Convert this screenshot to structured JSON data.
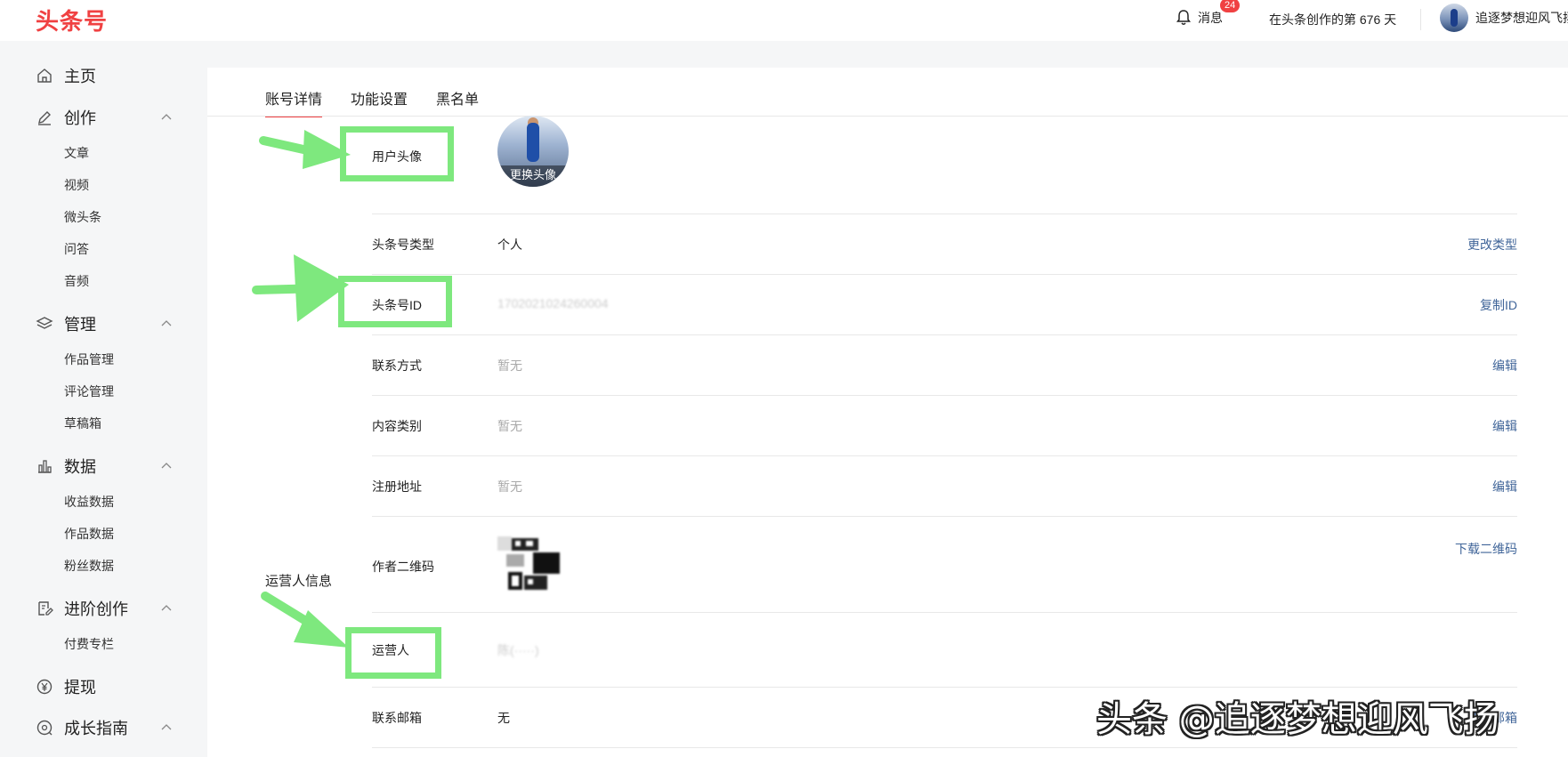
{
  "header": {
    "logo": "头条号",
    "messages_label": "消息",
    "messages_count": "24",
    "days_text": "在头条创作的第 676 天",
    "username": "追逐梦想迎风飞扬"
  },
  "sidebar": {
    "home": "主页",
    "create": {
      "label": "创作",
      "items": [
        "文章",
        "视频",
        "微头条",
        "问答",
        "音频"
      ]
    },
    "manage": {
      "label": "管理",
      "items": [
        "作品管理",
        "评论管理",
        "草稿箱"
      ]
    },
    "data": {
      "label": "数据",
      "items": [
        "收益数据",
        "作品数据",
        "粉丝数据"
      ]
    },
    "advanced": {
      "label": "进阶创作",
      "items": [
        "付费专栏"
      ]
    },
    "withdraw": "提现",
    "growth": "成长指南"
  },
  "tabs": [
    "账号详情",
    "功能设置",
    "黑名单"
  ],
  "account": {
    "avatar_label": "用户头像",
    "avatar_action": "更换头像",
    "type": {
      "label": "头条号类型",
      "value": "个人",
      "action": "更改类型"
    },
    "id": {
      "label": "头条号ID",
      "value": "1702021024260004",
      "action": "复制ID"
    },
    "contact": {
      "label": "联系方式",
      "value": "暂无",
      "action": "编辑"
    },
    "category": {
      "label": "内容类别",
      "value": "暂无",
      "action": "编辑"
    },
    "address": {
      "label": "注册地址",
      "value": "暂无",
      "action": "编辑"
    },
    "qrcode": {
      "label": "作者二维码",
      "action": "下载二维码"
    }
  },
  "operator": {
    "section_label": "运营人信息",
    "name": {
      "label": "运营人",
      "value": "陈(·····)"
    },
    "email": {
      "label": "联系邮箱",
      "value": "无",
      "action": "填写邮箱"
    }
  },
  "watermark": "头条 @追逐梦想迎风飞扬",
  "colors": {
    "brand": "#f04142",
    "link": "#406599",
    "annotation": "#7ee87e"
  }
}
